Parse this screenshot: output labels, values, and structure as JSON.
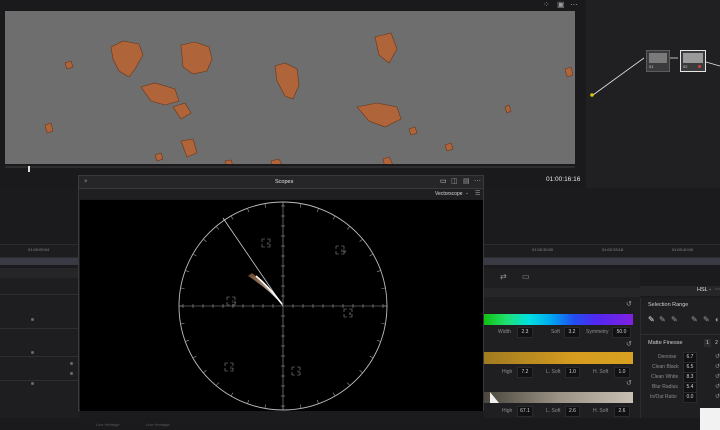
{
  "viewer": {
    "timecode": "01:00:16:16",
    "frame_color": "#6e6e6e",
    "skin_color": "#b0643a"
  },
  "nodes": {
    "node1_label": "01",
    "node2_label": "02"
  },
  "scopes": {
    "title": "Scopes",
    "mode": "Vectorscope",
    "targets": [
      "R",
      "Mg",
      "B",
      "Cy",
      "G",
      "Yl"
    ],
    "trace_color": "#ffe6c8"
  },
  "timeline": {
    "ruler_labels": [
      "01:00:09:04",
      "01:00:30:00",
      "01:00:33:18",
      "01:00:40:00"
    ]
  },
  "qualifier": {
    "mode": "HSL",
    "hue": {
      "width_label": "Width",
      "width": "2.3",
      "soft_label": "Soft",
      "soft": "3.2",
      "symmetry_label": "Symmetry",
      "symmetry": "50.0"
    },
    "sat": {
      "high_label": "High",
      "high": "7.2",
      "lsoft_label": "L. Soft",
      "lsoft": "1.0",
      "hsoft_label": "H. Soft",
      "hsoft": "1.0"
    },
    "lum": {
      "high_label": "High",
      "high": "67.1",
      "lsoft_label": "L. Soft",
      "lsoft": "2.6",
      "hsoft_label": "H. Soft",
      "hsoft": "2.6"
    }
  },
  "selection_range": {
    "title": "Selection Range"
  },
  "matte_finesse": {
    "title": "Matte Finesse",
    "tabs": [
      "1",
      "2"
    ],
    "rows": [
      {
        "label": "Denoise",
        "value": "6.7"
      },
      {
        "label": "Clean Black",
        "value": "6.5"
      },
      {
        "label": "Clean White",
        "value": "8.3"
      },
      {
        "label": "Blur Radius",
        "value": "5.4"
      },
      {
        "label": "In/Out Ratio",
        "value": "0.0"
      }
    ]
  },
  "footer": {
    "labels": [
      "Live Heritage",
      "Live Heritage"
    ]
  }
}
